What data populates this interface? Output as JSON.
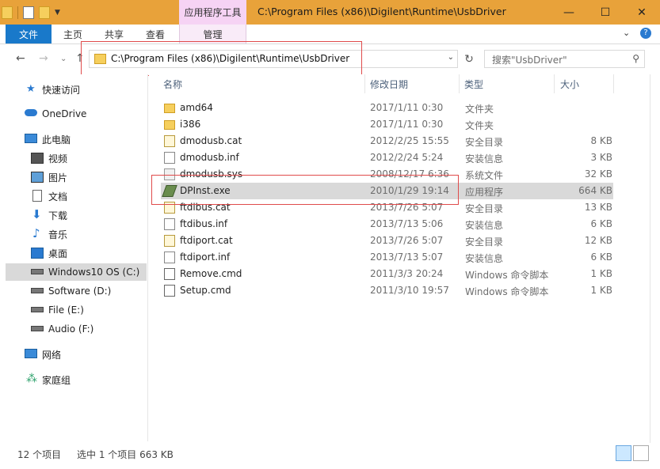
{
  "window": {
    "title": "C:\\Program Files (x86)\\Digilent\\Runtime\\UsbDriver",
    "context_tab_title": "应用程序工具",
    "minimize": "—",
    "maximize": "☐",
    "close": "✕"
  },
  "ribbon": {
    "tabs": [
      "文件",
      "主页",
      "共享",
      "查看",
      "管理"
    ],
    "collapse": "⌄",
    "help": "?"
  },
  "nav": {
    "back": "←",
    "forward": "→",
    "recent": "⌄",
    "up": "↑",
    "address": "C:\\Program Files (x86)\\Digilent\\Runtime\\UsbDriver",
    "address_dropdown": "⌄",
    "refresh": "↻",
    "search_placeholder": "搜索\"UsbDriver\"",
    "search_icon": "⚲"
  },
  "sidebar": {
    "items": [
      {
        "label": "快速访问",
        "icon": "star-icon"
      },
      {
        "label": "OneDrive",
        "icon": "cloud-icon"
      },
      {
        "label": "此电脑",
        "icon": "computer-icon"
      },
      {
        "label": "视频",
        "icon": "video-icon"
      },
      {
        "label": "图片",
        "icon": "picture-icon"
      },
      {
        "label": "文档",
        "icon": "document-icon"
      },
      {
        "label": "下载",
        "icon": "download-icon"
      },
      {
        "label": "音乐",
        "icon": "music-icon"
      },
      {
        "label": "桌面",
        "icon": "desktop-icon"
      },
      {
        "label": "Windows10 OS (C:)",
        "icon": "drive-icon",
        "selected": true
      },
      {
        "label": "Software (D:)",
        "icon": "drive-icon"
      },
      {
        "label": "File (E:)",
        "icon": "drive-icon"
      },
      {
        "label": "Audio (F:)",
        "icon": "drive-icon"
      },
      {
        "label": "网络",
        "icon": "network-icon"
      },
      {
        "label": "家庭组",
        "icon": "homegroup-icon"
      }
    ]
  },
  "columns": [
    "名称",
    "修改日期",
    "类型",
    "大小"
  ],
  "files": [
    {
      "name": "amd64",
      "date": "2017/1/11 0:30",
      "type": "文件夹",
      "size": "",
      "icon": "folder-icon"
    },
    {
      "name": "i386",
      "date": "2017/1/11 0:30",
      "type": "文件夹",
      "size": "",
      "icon": "folder-icon"
    },
    {
      "name": "dmodusb.cat",
      "date": "2012/2/25 15:55",
      "type": "安全目录",
      "size": "8 KB",
      "icon": "catalog-icon"
    },
    {
      "name": "dmodusb.inf",
      "date": "2012/2/24 5:24",
      "type": "安装信息",
      "size": "3 KB",
      "icon": "setup-info-icon"
    },
    {
      "name": "dmodusb.sys",
      "date": "2008/12/17 6:36",
      "type": "系统文件",
      "size": "32 KB",
      "icon": "system-file-icon"
    },
    {
      "name": "DPInst.exe",
      "date": "2010/1/29 19:14",
      "type": "应用程序",
      "size": "664 KB",
      "icon": "application-icon",
      "selected": true
    },
    {
      "name": "ftdibus.cat",
      "date": "2013/7/26 5:07",
      "type": "安全目录",
      "size": "13 KB",
      "icon": "catalog-icon"
    },
    {
      "name": "ftdibus.inf",
      "date": "2013/7/13 5:06",
      "type": "安装信息",
      "size": "6 KB",
      "icon": "setup-info-icon"
    },
    {
      "name": "ftdiport.cat",
      "date": "2013/7/26 5:07",
      "type": "安全目录",
      "size": "12 KB",
      "icon": "catalog-icon"
    },
    {
      "name": "ftdiport.inf",
      "date": "2013/7/13 5:07",
      "type": "安装信息",
      "size": "6 KB",
      "icon": "setup-info-icon"
    },
    {
      "name": "Remove.cmd",
      "date": "2011/3/3 20:24",
      "type": "Windows 命令脚本",
      "size": "1 KB",
      "icon": "script-icon"
    },
    {
      "name": "Setup.cmd",
      "date": "2011/3/10 19:57",
      "type": "Windows 命令脚本",
      "size": "1 KB",
      "icon": "script-icon"
    }
  ],
  "status": {
    "count": "12 个项目",
    "selection": "选中 1 个项目 663 KB"
  },
  "colors": {
    "titlebar": "#e8a23a",
    "file_tab": "#1979ca",
    "selection": "#d9d9d9",
    "annotation_box": "#e04b4b"
  }
}
